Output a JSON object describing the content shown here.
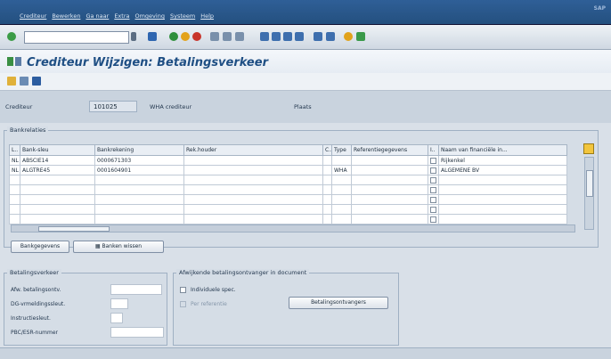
{
  "menu": [
    "Crediteur",
    "Bewerken",
    "Ga naar",
    "Extra",
    "Omgeving",
    "Systeem",
    "Help"
  ],
  "brand": "SAP",
  "command_field": {
    "value": ""
  },
  "title": "Crediteur Wijzigen: Betalingsverkeer",
  "header": {
    "crediteur_label": "Crediteur",
    "crediteur_value": "101025",
    "wha_label": "WHA crediteur",
    "plaats_label": "Plaats"
  },
  "bank_section": {
    "title": "Bankrelaties",
    "columns": [
      "L..",
      "Bank-sleu",
      "Bankrekening",
      "Rek.houder",
      "C..",
      "Type",
      "Referentiegegevens",
      "I..",
      "Naam van financiële in..."
    ],
    "rows": [
      [
        "NL",
        "ABSCIE14",
        "0000671303",
        "",
        "",
        "",
        "",
        "",
        "Rijkenkel"
      ],
      [
        "NL",
        "ALGTRE45",
        "0001604901",
        "",
        "",
        "WHA",
        "",
        "",
        "ALGEMENE BV"
      ]
    ]
  },
  "buttons": {
    "bankgegevens": "Bankgegevens",
    "banken_wissen": "Banken wissen",
    "betalingsontvangers": "Betalingsontvangers"
  },
  "betalingsverkeer": {
    "title": "Betalingsverkeer",
    "labels": [
      "Afw. betalingsontv.",
      "DG-vrmeldingssleut.",
      "Instructiesleut.",
      "PBC/ESR-nummer"
    ]
  },
  "afwijkende": {
    "title": "Afwijkende betalingsontvanger in document",
    "checkbox1": "Individuele spec.",
    "checkbox2": "Per referentie"
  }
}
